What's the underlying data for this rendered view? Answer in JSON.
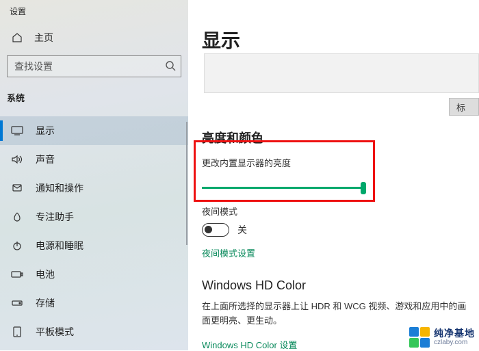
{
  "sidebar": {
    "header": "设置",
    "home": "主页",
    "search_placeholder": "查找设置",
    "section": "系统",
    "items": [
      {
        "label": "显示"
      },
      {
        "label": "声音"
      },
      {
        "label": "通知和操作"
      },
      {
        "label": "专注助手"
      },
      {
        "label": "电源和睡眠"
      },
      {
        "label": "电池"
      },
      {
        "label": "存储"
      },
      {
        "label": "平板模式"
      }
    ]
  },
  "main": {
    "title": "显示",
    "mark_btn": "标",
    "brightness": {
      "title": "亮度和颜色",
      "sub": "更改内置显示器的亮度",
      "night_label": "夜间模式",
      "toggle_state": "关",
      "link": "夜间模式设置"
    },
    "hd": {
      "title": "Windows HD Color",
      "desc": "在上面所选择的显示器上让 HDR 和 WCG 视频、游戏和应用中的画面更明亮、更生动。",
      "link": "Windows HD Color 设置"
    }
  },
  "watermark": {
    "cn": "纯净基地",
    "en": "czlaby.com"
  }
}
